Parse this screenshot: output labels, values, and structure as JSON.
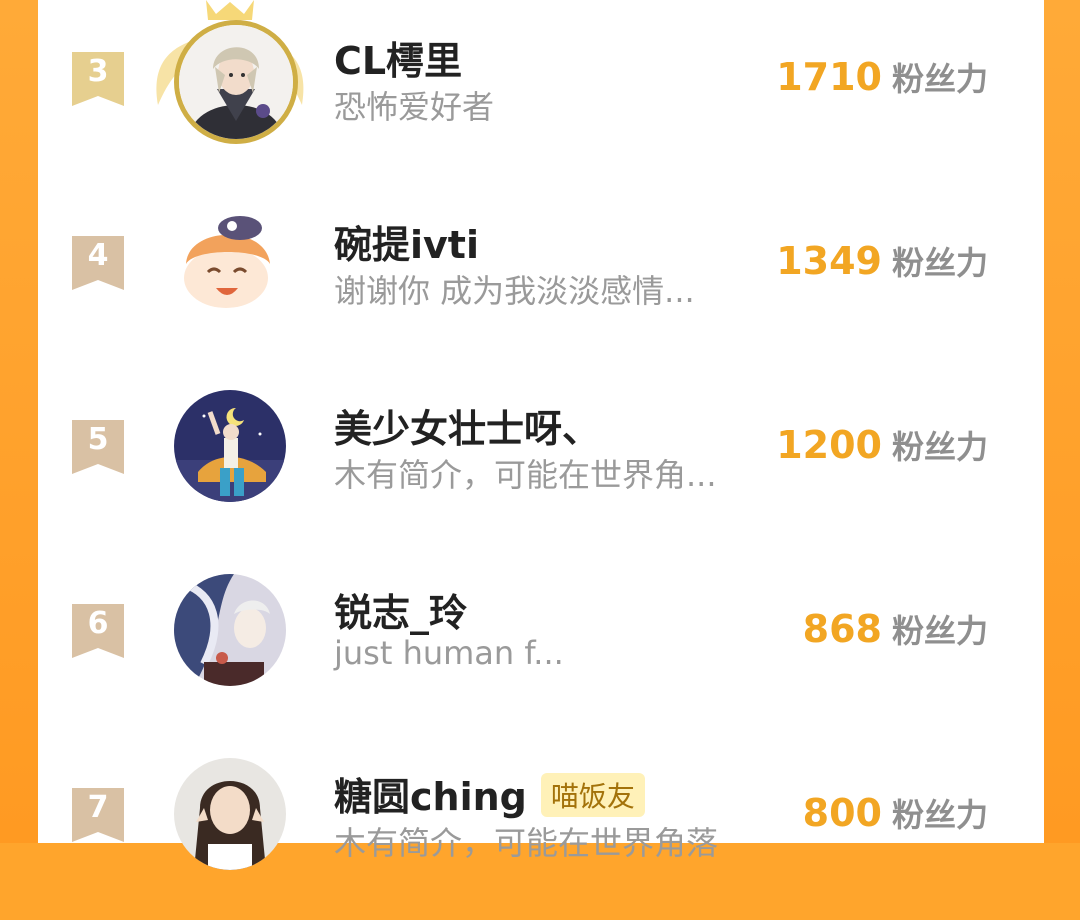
{
  "score_unit": "粉丝力",
  "rows": [
    {
      "rank": "3",
      "name": "CL樗里",
      "bio": "恐怖爱好者",
      "score": "1710"
    },
    {
      "rank": "4",
      "name": "碗提ivti",
      "bio": "谢谢你 成为我淡淡感情...",
      "score": "1349"
    },
    {
      "rank": "5",
      "name": "美少女壮士呀、",
      "bio": "木有简介，可能在世界角...",
      "score": "1200"
    },
    {
      "rank": "6",
      "name": "锐志_玲",
      "bio": "just human f...",
      "score": "868"
    },
    {
      "rank": "7",
      "name": "糖圆ching",
      "tag": "喵饭友",
      "bio": "木有简介，可能在世界角落",
      "score": "800"
    }
  ],
  "colors": {
    "background_orange": "#ffa52c",
    "score_orange": "#f2a623",
    "rank_badge_gold": "#e6cf8f",
    "rank_badge_tan": "#d9c1a4"
  }
}
